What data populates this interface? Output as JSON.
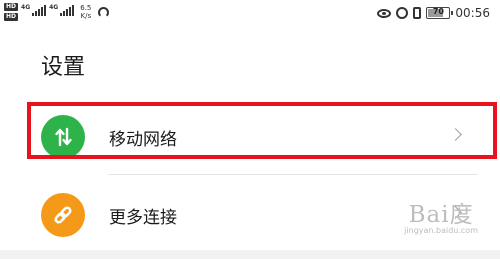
{
  "status_bar": {
    "hd_badge": "HD",
    "network_gen": "4G",
    "net_speed_value": "6.5",
    "net_speed_unit": "K/s",
    "battery_level": "70",
    "time": "00:56"
  },
  "page": {
    "title": "设置"
  },
  "settings_items": [
    {
      "label": "移动网络",
      "icon": "mobile-data-arrows-icon",
      "icon_color": "#2eb34b",
      "highlighted": true
    },
    {
      "label": "更多连接",
      "icon": "link-icon",
      "icon_color": "#f59a18"
    }
  ],
  "highlight_color": "#e8141d",
  "watermark": {
    "logo": "Bai度",
    "url": "jingyan.baidu.com"
  }
}
